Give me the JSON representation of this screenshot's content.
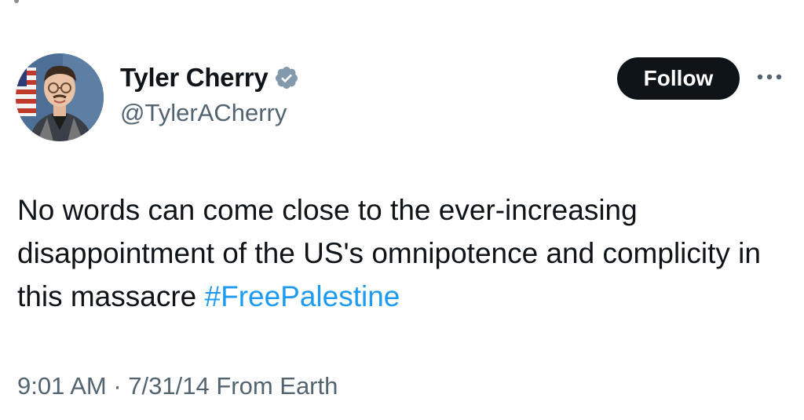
{
  "author": {
    "display_name": "Tyler Cherry",
    "handle": "@TylerACherry",
    "verified_icon": "verified-badge-icon",
    "avatar_icon": "profile-photo"
  },
  "actions": {
    "follow_label": "Follow",
    "more_icon": "more-options-icon"
  },
  "tweet": {
    "text": "No words can come close to the ever-increasing disappointment of the US's omnipotence and complicity in this massacre ",
    "hashtag": "#FreePalestine",
    "timestamp": "9:01 AM · 7/31/14 From Earth"
  },
  "colors": {
    "text": "#0f1419",
    "secondary_text": "#536471",
    "link": "#1d9bf0",
    "button_bg": "#0f1419",
    "button_text": "#ffffff",
    "verified_badge": "#829aab"
  }
}
